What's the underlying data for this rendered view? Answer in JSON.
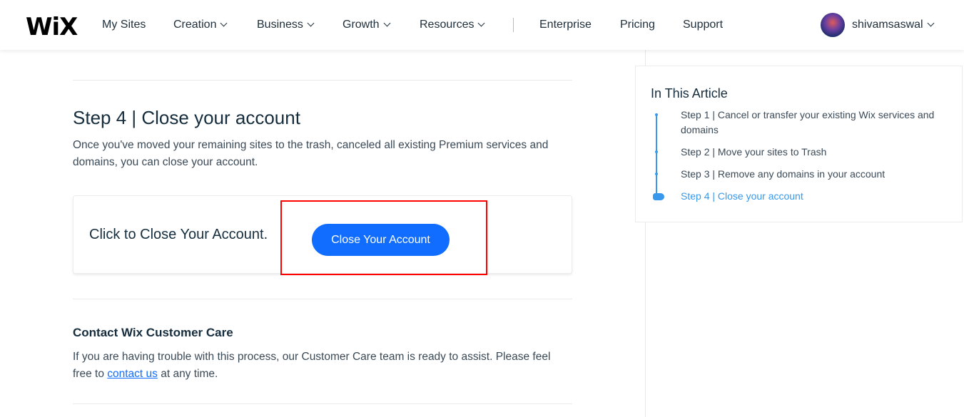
{
  "header": {
    "logo": "WiX",
    "nav": [
      {
        "label": "My Sites",
        "dropdown": false
      },
      {
        "label": "Creation",
        "dropdown": true
      },
      {
        "label": "Business",
        "dropdown": true
      },
      {
        "label": "Growth",
        "dropdown": true
      },
      {
        "label": "Resources",
        "dropdown": true
      },
      {
        "label": "Enterprise",
        "dropdown": false
      },
      {
        "label": "Pricing",
        "dropdown": false
      },
      {
        "label": "Support",
        "dropdown": false
      }
    ],
    "username": "shivamsaswal"
  },
  "article": {
    "step4_title": "Step 4 | Close your account",
    "step4_text": "Once you've moved your remaining sites to the trash, canceled all existing Premium services and domains, you can close your account.",
    "card_title": "Click to Close Your Account.",
    "close_button": "Close Your Account",
    "contact_title": "Contact Wix Customer Care",
    "contact_text_before": "If you are having trouble with this process, our Customer Care team is ready to assist. Please feel free to ",
    "contact_link": "contact us",
    "contact_text_after": " at any time."
  },
  "toc": {
    "title": "In This Article",
    "items": [
      "Step 1 | Cancel or transfer your existing Wix services and domains",
      "Step 2 | Move your sites to Trash",
      "Step 3 | Remove any domains in your account",
      "Step 4 | Close your account"
    ],
    "active_index": 3
  },
  "colors": {
    "accent": "#116dff",
    "toc_accent": "#3899ec",
    "highlight": "#ff0000"
  }
}
